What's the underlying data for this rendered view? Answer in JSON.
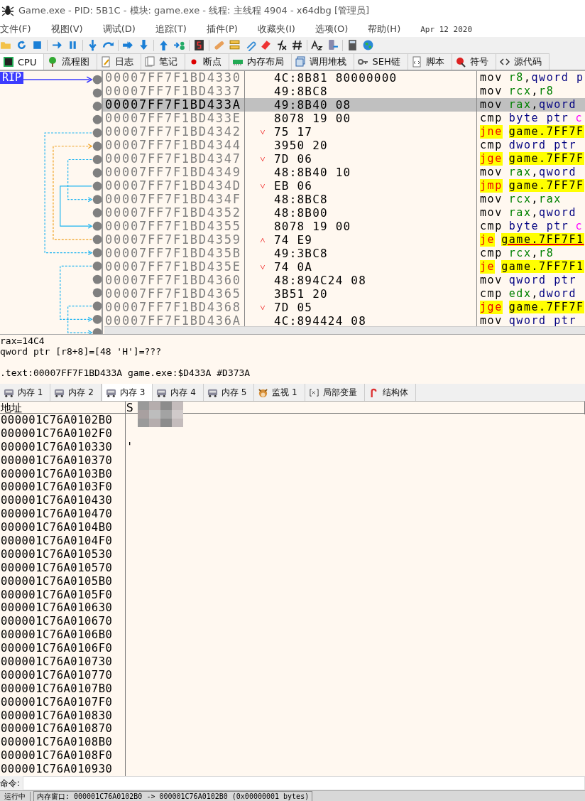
{
  "window": {
    "title": "Game.exe - PID: 5B1C - 模块: game.exe - 线程: 主线程 4904 - x64dbg [管理员]"
  },
  "menu": {
    "items": [
      "文件(F)",
      "视图(V)",
      "调试(D)",
      "追踪(T)",
      "插件(P)",
      "收藏夹(I)",
      "选项(O)",
      "帮助(H)"
    ],
    "build_date": "Apr 12 2020"
  },
  "tabs": [
    {
      "label": "CPU",
      "selected": true
    },
    {
      "label": "流程图",
      "selected": false
    },
    {
      "label": "日志",
      "selected": false
    },
    {
      "label": "笔记",
      "selected": false
    },
    {
      "label": "断点",
      "selected": false
    },
    {
      "label": "内存布局",
      "selected": false
    },
    {
      "label": "调用堆栈",
      "selected": false
    },
    {
      "label": "SEH链",
      "selected": false
    },
    {
      "label": "脚本",
      "selected": false
    },
    {
      "label": "符号",
      "selected": false
    },
    {
      "label": "源代码",
      "selected": false
    }
  ],
  "disassembly": {
    "rip_label": "RIP",
    "rows": [
      {
        "address": "00007FF7F1BD4330",
        "bytes": "4C:8B81 80000000",
        "selected": false,
        "kind": "normal",
        "mnemonic": "mov",
        "operands": [
          {
            "text": "r8",
            "kind": "register"
          },
          {
            "text": ",",
            "kind": "plain"
          },
          {
            "text": "qword p",
            "kind": "keyword"
          }
        ]
      },
      {
        "address": "00007FF7F1BD4337",
        "bytes": "49:8BC8",
        "selected": false,
        "kind": "normal",
        "mnemonic": "mov",
        "operands": [
          {
            "text": "rcx",
            "kind": "register"
          },
          {
            "text": ",",
            "kind": "plain"
          },
          {
            "text": "r8",
            "kind": "register"
          }
        ]
      },
      {
        "address": "00007FF7F1BD433A",
        "bytes": "49:8B40 08",
        "selected": true,
        "kind": "normal",
        "mnemonic": "mov",
        "operands": [
          {
            "text": "rax",
            "kind": "register"
          },
          {
            "text": ",",
            "kind": "plain"
          },
          {
            "text": "qword",
            "kind": "keyword"
          }
        ]
      },
      {
        "address": "00007FF7F1BD433E",
        "bytes": "8078 19 00",
        "selected": false,
        "kind": "normal",
        "mnemonic": "cmp",
        "operands": [
          {
            "text": "byte ptr",
            "kind": "keyword"
          },
          {
            "text": "c",
            "kind": "segment"
          }
        ]
      },
      {
        "address": "00007FF7F1BD4342",
        "branch": "˅",
        "bytes": "75 17",
        "selected": false,
        "kind": "jump",
        "underlined": false,
        "mnemonic": "jne",
        "operands": [
          {
            "text": "game.7FF7F",
            "kind": "target"
          }
        ]
      },
      {
        "address": "00007FF7F1BD4344",
        "bytes": "3950 20",
        "selected": false,
        "kind": "normal",
        "mnemonic": "cmp",
        "operands": [
          {
            "text": "dword ptr",
            "kind": "keyword"
          }
        ]
      },
      {
        "address": "00007FF7F1BD4347",
        "branch": "˅",
        "bytes": "7D 06",
        "selected": false,
        "kind": "jump",
        "underlined": false,
        "mnemonic": "jge",
        "operands": [
          {
            "text": "game.7FF7F",
            "kind": "target"
          }
        ]
      },
      {
        "address": "00007FF7F1BD4349",
        "bytes": "48:8B40 10",
        "selected": false,
        "kind": "normal",
        "mnemonic": "mov",
        "operands": [
          {
            "text": "rax",
            "kind": "register"
          },
          {
            "text": ",",
            "kind": "plain"
          },
          {
            "text": "qword",
            "kind": "keyword"
          }
        ]
      },
      {
        "address": "00007FF7F1BD434D",
        "branch": "˅",
        "bytes": "EB 06",
        "selected": false,
        "kind": "jump",
        "underlined": false,
        "mnemonic": "jmp",
        "operands": [
          {
            "text": "game.7FF7F",
            "kind": "target"
          }
        ]
      },
      {
        "address": "00007FF7F1BD434F",
        "bytes": "48:8BC8",
        "selected": false,
        "kind": "normal",
        "mnemonic": "mov",
        "operands": [
          {
            "text": "rcx",
            "kind": "register"
          },
          {
            "text": ",",
            "kind": "plain"
          },
          {
            "text": "rax",
            "kind": "register"
          }
        ]
      },
      {
        "address": "00007FF7F1BD4352",
        "bytes": "48:8B00",
        "selected": false,
        "kind": "normal",
        "mnemonic": "mov",
        "operands": [
          {
            "text": "rax",
            "kind": "register"
          },
          {
            "text": ",",
            "kind": "plain"
          },
          {
            "text": "qword",
            "kind": "keyword"
          }
        ]
      },
      {
        "address": "00007FF7F1BD4355",
        "bytes": "8078 19 00",
        "selected": false,
        "kind": "normal",
        "mnemonic": "cmp",
        "operands": [
          {
            "text": "byte ptr",
            "kind": "keyword"
          },
          {
            "text": "c",
            "kind": "segment"
          }
        ]
      },
      {
        "address": "00007FF7F1BD4359",
        "branch": "˄",
        "bytes": "74 E9",
        "selected": false,
        "kind": "jump",
        "underlined": true,
        "mnemonic": "je",
        "operands": [
          {
            "text": "game.7FF7F1",
            "kind": "target"
          }
        ]
      },
      {
        "address": "00007FF7F1BD435B",
        "bytes": "49:3BC8",
        "selected": false,
        "kind": "normal",
        "mnemonic": "cmp",
        "operands": [
          {
            "text": "rcx",
            "kind": "register"
          },
          {
            "text": ",",
            "kind": "plain"
          },
          {
            "text": "r8",
            "kind": "register"
          }
        ]
      },
      {
        "address": "00007FF7F1BD435E",
        "branch": "˅",
        "bytes": "74 0A",
        "selected": false,
        "kind": "jump",
        "underlined": false,
        "mnemonic": "je",
        "operands": [
          {
            "text": "game.7FF7F1",
            "kind": "target"
          }
        ]
      },
      {
        "address": "00007FF7F1BD4360",
        "bytes": "48:894C24 08",
        "selected": false,
        "kind": "normal",
        "mnemonic": "mov",
        "operands": [
          {
            "text": "qword ptr",
            "kind": "keyword"
          }
        ]
      },
      {
        "address": "00007FF7F1BD4365",
        "bytes": "3B51 20",
        "selected": false,
        "kind": "normal",
        "mnemonic": "cmp",
        "operands": [
          {
            "text": "edx",
            "kind": "register"
          },
          {
            "text": ",",
            "kind": "plain"
          },
          {
            "text": "dword",
            "kind": "keyword"
          }
        ]
      },
      {
        "address": "00007FF7F1BD4368",
        "branch": "˅",
        "bytes": "7D 05",
        "selected": false,
        "kind": "jump",
        "underlined": false,
        "mnemonic": "jge",
        "operands": [
          {
            "text": "game.7FF7F",
            "kind": "target"
          }
        ]
      },
      {
        "address": "00007FF7F1BD436A",
        "bytes": "4C:894424 08",
        "selected": false,
        "kind": "normal",
        "mnemonic": "mov",
        "operands": [
          {
            "text": "qword ptr",
            "kind": "keyword"
          }
        ]
      }
    ]
  },
  "info": {
    "lines": [
      "rax=14C4",
      "qword ptr [r8+8]=[48 'H']=???"
    ],
    "location": ".text:00007FF7F1BD433A game.exe:$D433A #D373A"
  },
  "memory_tabs": [
    {
      "label": "内存 1",
      "kind": "memory",
      "selected": false
    },
    {
      "label": "内存 2",
      "kind": "memory",
      "selected": false
    },
    {
      "label": "内存 3",
      "kind": "memory",
      "selected": true
    },
    {
      "label": "内存 4",
      "kind": "memory",
      "selected": false
    },
    {
      "label": "内存 5",
      "kind": "memory",
      "selected": false
    },
    {
      "label": "监视 1",
      "kind": "watch",
      "selected": false
    },
    {
      "label": "局部变量",
      "kind": "locals",
      "selected": false
    },
    {
      "label": "结构体",
      "kind": "struct",
      "selected": false
    }
  ],
  "dump": {
    "columns": [
      "地址",
      "S"
    ],
    "rows": [
      {
        "address": "000001C76A0102B0"
      },
      {
        "address": "000001C76A0102F0"
      },
      {
        "address": "000001C76A010330",
        "text": "'"
      },
      {
        "address": "000001C76A010370"
      },
      {
        "address": "000001C76A0103B0"
      },
      {
        "address": "000001C76A0103F0"
      },
      {
        "address": "000001C76A010430"
      },
      {
        "address": "000001C76A010470"
      },
      {
        "address": "000001C76A0104B0"
      },
      {
        "address": "000001C76A0104F0"
      },
      {
        "address": "000001C76A010530"
      },
      {
        "address": "000001C76A010570"
      },
      {
        "address": "000001C76A0105B0"
      },
      {
        "address": "000001C76A0105F0"
      },
      {
        "address": "000001C76A010630"
      },
      {
        "address": "000001C76A010670"
      },
      {
        "address": "000001C76A0106B0"
      },
      {
        "address": "000001C76A0106F0"
      },
      {
        "address": "000001C76A010730"
      },
      {
        "address": "000001C76A010770"
      },
      {
        "address": "000001C76A0107B0"
      },
      {
        "address": "000001C76A0107F0"
      },
      {
        "address": "000001C76A010830"
      },
      {
        "address": "000001C76A010870"
      },
      {
        "address": "000001C76A0108B0"
      },
      {
        "address": "000001C76A0108F0"
      },
      {
        "address": "000001C76A010930"
      }
    ]
  },
  "command": {
    "label": "命令:"
  },
  "status_bar": {
    "state": "运行中",
    "message": "内存窗口: 000001C76A0102B0 -> 000001C76A0102B0 (0x00000001 bytes)"
  }
}
